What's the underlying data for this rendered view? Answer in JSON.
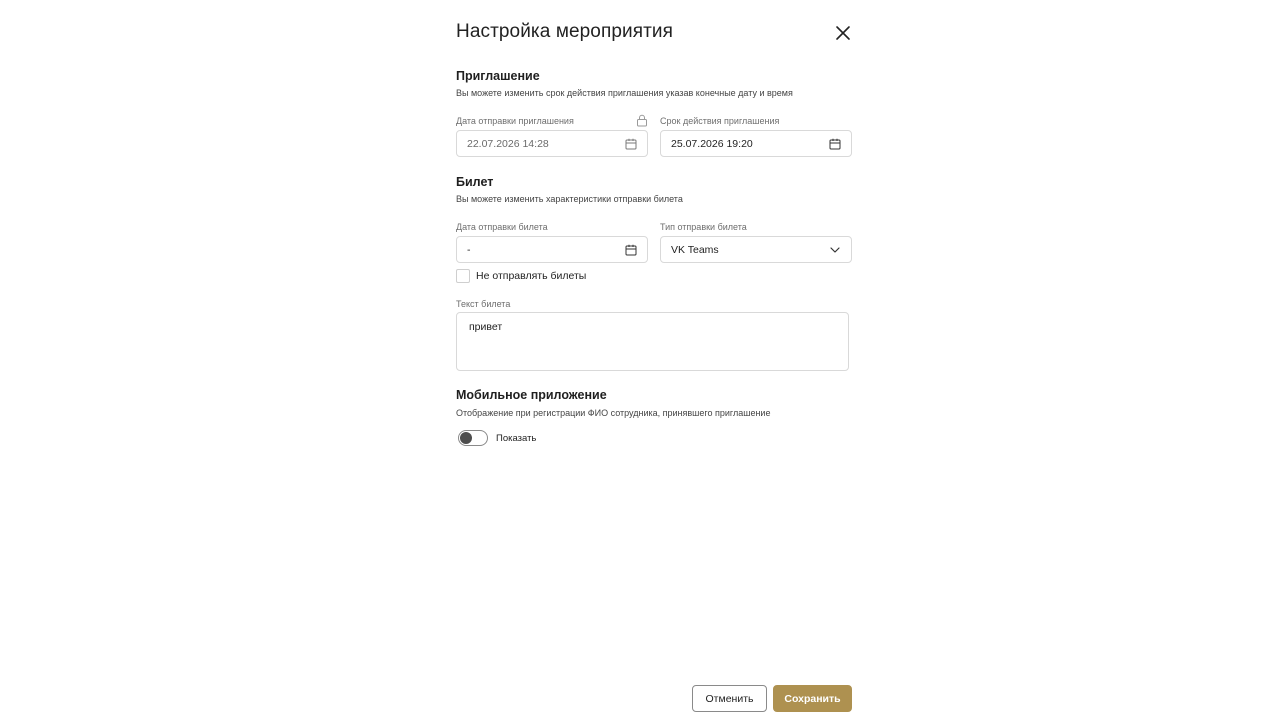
{
  "dialog": {
    "title": "Настройка мероприятия",
    "close_icon": "close-icon"
  },
  "invitation": {
    "title": "Приглашение",
    "description": "Вы можете изменить срок действия приглашения указав конечные дату и время",
    "send_date_label": "Дата отправки приглашения",
    "send_date_value": "22.07.2026 14:28",
    "send_date_locked_icon": "lock-icon",
    "expiry_label": "Срок действия приглашения",
    "expiry_value": "25.07.2026 19:20"
  },
  "ticket": {
    "title": "Билет",
    "description": "Вы можете изменить характеристики отправки билета",
    "send_date_label": "Дата отправки билета",
    "send_date_value": "-",
    "send_type_label": "Тип отправки билета",
    "send_type_value": "VK Teams",
    "dont_send_label": "Не отправлять билеты",
    "dont_send_checked": false,
    "text_label": "Текст билета",
    "text_value": "привет"
  },
  "mobile": {
    "title": "Мобильное приложение",
    "description": "Отображение при регистрации ФИО сотрудника, принявшего приглашение",
    "toggle_label": "Показать",
    "toggle_on": false
  },
  "footer": {
    "cancel_label": "Отменить",
    "save_label": "Сохранить"
  },
  "colors": {
    "accent": "#ae9150",
    "border": "#d9d9d9",
    "text": "#1f1f1f"
  }
}
